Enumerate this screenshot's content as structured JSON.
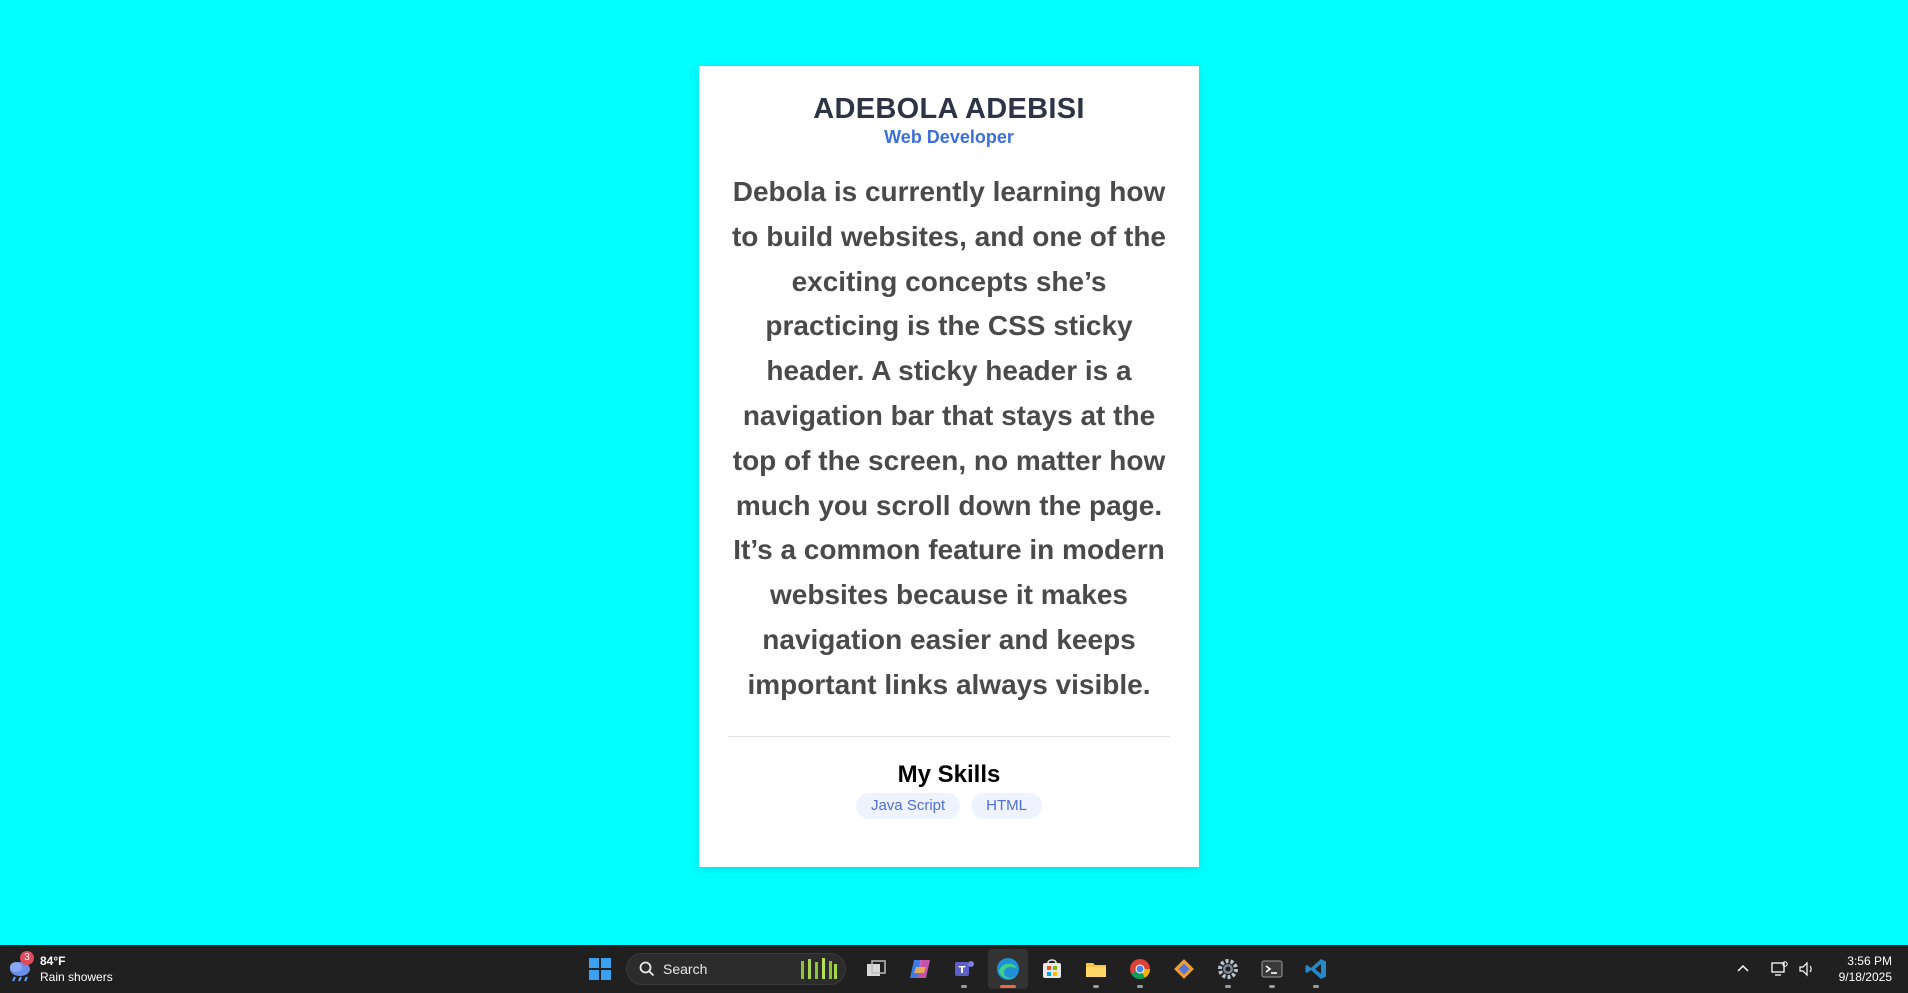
{
  "profile": {
    "name": "ADEBOLA ADEBISI",
    "role": "Web Developer",
    "bio": "Debola is currently learning how to build websites, and one of the exciting concepts she’s practicing is the CSS sticky header. A sticky header is a navigation bar that stays at the top of the screen, no matter how much you scroll down the page. It’s a common feature in modern websites because it makes navigation easier and keeps important links always visible.",
    "skills_title": "My Skills",
    "skills": [
      "Java Script",
      "HTML"
    ]
  },
  "colors": {
    "background": "#00ffff",
    "card": "#ffffff",
    "name": "#2c3446",
    "role": "#3b6fd9",
    "bio": "#4a4a4a",
    "skill_bg": "#eef3ff",
    "skill_text": "#4d6fd6",
    "taskbar": "#202020"
  },
  "taskbar": {
    "weather": {
      "badge": "3",
      "temp": "84°F",
      "condition": "Rain showers",
      "icon": "weather-rain-icon"
    },
    "search_label": "Search",
    "apps": [
      {
        "name": "start-icon"
      },
      {
        "name": "task-view-icon"
      },
      {
        "name": "copilot-icon"
      },
      {
        "name": "teams-icon"
      },
      {
        "name": "edge-icon",
        "active": true
      },
      {
        "name": "store-icon"
      },
      {
        "name": "file-explorer-icon"
      },
      {
        "name": "chrome-icon"
      },
      {
        "name": "git-icon"
      },
      {
        "name": "settings-icon"
      },
      {
        "name": "terminal-icon"
      },
      {
        "name": "vscode-icon"
      }
    ],
    "tray": {
      "time": "3:56 PM",
      "date": "9/18/2025"
    }
  }
}
